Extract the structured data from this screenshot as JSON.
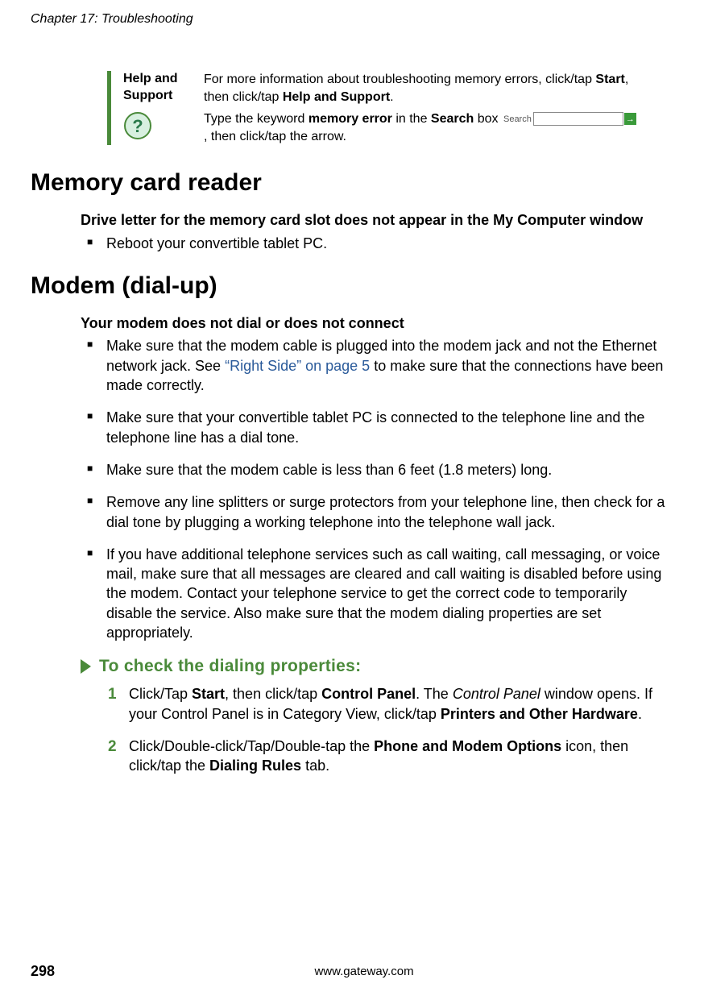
{
  "header": {
    "chapter": "Chapter 17: Troubleshooting"
  },
  "helpBox": {
    "label1": "Help and",
    "label2": "Support",
    "line1a": "For more information about troubleshooting memory errors, click/tap ",
    "line1b": "Start",
    "line1c": ", then click/tap ",
    "line1d": "Help and Support",
    "line1e": ".",
    "line2a": "Type the keyword ",
    "line2b": "memory error",
    "line2c": " in the ",
    "line2d": "Search",
    "line2e": " box ",
    "searchLabel": "Search",
    "line2f": ", then click/tap the arrow."
  },
  "section1": {
    "title": "Memory card reader",
    "issue1": {
      "title": "Drive letter for the memory card slot does not appear in the My Computer window",
      "b1": "Reboot your convertible tablet PC."
    }
  },
  "section2": {
    "title": "Modem (dial-up)",
    "issue1": {
      "title": "Your modem does not dial or does not connect",
      "b1a": "Make sure that the modem cable is plugged into the modem jack and not the Ethernet network jack. See ",
      "b1link": "“Right Side” on page 5",
      "b1b": " to make sure that the connections have been made correctly.",
      "b2": "Make sure that your convertible tablet PC is connected to the telephone line and the telephone line has a dial tone.",
      "b3": "Make sure that the modem cable is less than 6 feet (1.8 meters) long.",
      "b4": "Remove any line splitters or surge protectors from your telephone line, then check for a dial tone by plugging a working telephone into the telephone wall jack.",
      "b5": "If you have additional telephone services such as call waiting, call messaging, or voice mail, make sure that all messages are cleared and call waiting is disabled before using the modem. Contact your telephone service to get the correct code to temporarily disable the service. Also make sure that the modem dialing properties are set appropriately."
    },
    "proc": {
      "title": "To check the dialing properties:",
      "s1a": "Click/Tap ",
      "s1b": "Start",
      "s1c": ", then click/tap ",
      "s1d": "Control Panel",
      "s1e": ". The ",
      "s1f": "Control Panel",
      "s1g": " window opens. If your Control Panel is in Category View, click/tap ",
      "s1h": "Printers and Other Hardware",
      "s1i": ".",
      "s2a": "Click/Double-click/Tap/Double-tap the ",
      "s2b": "Phone and Modem Options",
      "s2c": " icon, then click/tap the ",
      "s2d": "Dialing Rules",
      "s2e": " tab."
    }
  },
  "footer": {
    "pageNum": "298",
    "url": "www.gateway.com"
  }
}
